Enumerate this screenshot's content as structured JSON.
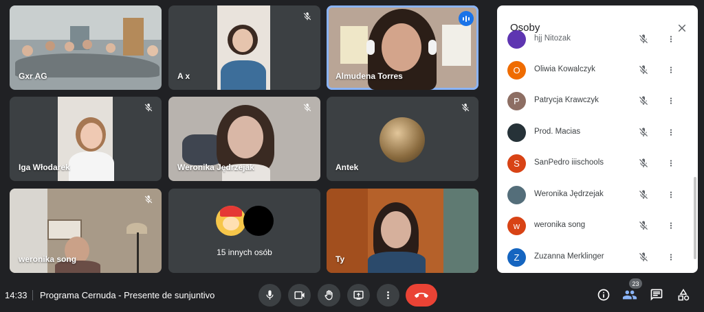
{
  "tiles": [
    {
      "name": "Gxr AG",
      "muted": false
    },
    {
      "name": "A x",
      "muted": true
    },
    {
      "name": "Almudena Torres",
      "speaking": true
    },
    {
      "name": "Iga Włodarek",
      "muted": true
    },
    {
      "name": "Weronika Jędrzejak",
      "muted": true
    },
    {
      "name": "Antek",
      "muted": true
    },
    {
      "name": "weronika song",
      "muted": true
    },
    {
      "name": "15 innych osób",
      "muted": false
    },
    {
      "name": "Ty",
      "muted": false
    }
  ],
  "people_panel": {
    "title": "Osoby",
    "participants": [
      {
        "initial": "",
        "name": "hjj Nitozak",
        "color": "#5e35b1"
      },
      {
        "initial": "O",
        "name": "Oliwia Kowalczyk",
        "color": "#ef6c00"
      },
      {
        "initial": "P",
        "name": "Patrycja Krawczyk",
        "color": "#8d6e63"
      },
      {
        "initial": "",
        "name": "Prod. Macias",
        "color": "#263238"
      },
      {
        "initial": "S",
        "name": "SanPedro iiischools",
        "color": "#d84315"
      },
      {
        "initial": "",
        "name": "Weronika Jędrzejak",
        "color": "#546e7a"
      },
      {
        "initial": "w",
        "name": "weronika song",
        "color": "#d84315"
      },
      {
        "initial": "Z",
        "name": "Zuzanna Merklinger",
        "color": "#1565c0"
      }
    ]
  },
  "bottom_bar": {
    "time": "14:33",
    "meeting_title": "Programa Cernuda - Presente de sunjuntivo",
    "participant_count": "23"
  },
  "icons": {
    "mic": "mic-icon",
    "camera": "camera-icon",
    "hand": "raise-hand-icon",
    "present": "present-screen-icon",
    "more": "more-vert-icon",
    "end": "end-call-icon",
    "info": "info-icon",
    "people": "people-icon",
    "chat": "chat-icon",
    "activities": "activities-icon"
  },
  "colors": {
    "accent": "#8ab4f8",
    "speaking": "#1a73e8",
    "end_call": "#ea4335"
  }
}
